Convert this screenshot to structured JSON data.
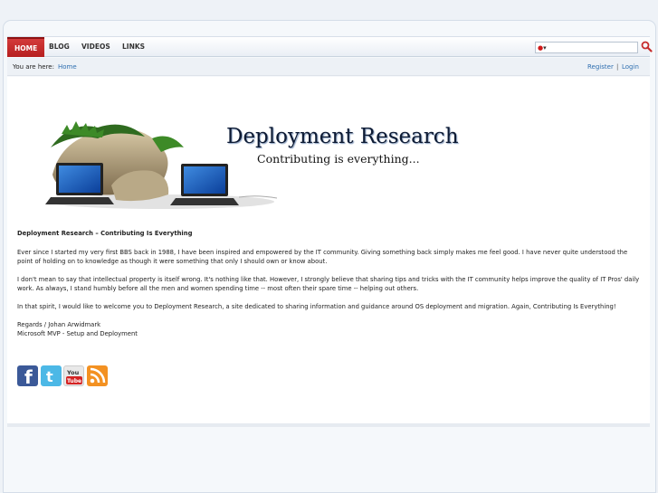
{
  "nav": {
    "items": [
      {
        "label": "HOME"
      },
      {
        "label": "BLOG"
      },
      {
        "label": "VIDEOS"
      },
      {
        "label": "LINKS"
      }
    ]
  },
  "search": {
    "value": "",
    "placeholder": "",
    "button_icon": "search-icon"
  },
  "breadcrumb": {
    "label": "You are here:",
    "home": "Home"
  },
  "auth": {
    "register": "Register",
    "separator": "|",
    "login": "Login"
  },
  "banner": {
    "title": "Deployment Research",
    "subtitle": "Contributing is everything..."
  },
  "article": {
    "heading": "Deployment Research – Contributing Is Everything",
    "p1": "Ever since I started my very first BBS back in 1988, I have been inspired and empowered by the IT community. Giving something back simply makes me feel good. I have never quite understood the point of holding on to knowledge as though it were something that only I should own or know about.",
    "p2": "I don't mean to say that intellectual property is itself wrong. It's nothing like that. However, I strongly believe that sharing tips and tricks with the IT community helps improve the quality of IT Pros' daily work. As always, I stand humbly before all the men and women spending time -- most often their spare time -- helping out others.",
    "p3": "In that spirit, I would like to welcome you to Deployment Research, a site dedicated to sharing information and guidance around OS deployment and migration. Again, Contributing Is Everything!",
    "sig1": "Regards / Johan Arwidmark",
    "sig2": "Microsoft MVP - Setup and Deployment"
  },
  "social": [
    {
      "icon": "facebook-icon",
      "color": "#3b5998"
    },
    {
      "icon": "twitter-icon",
      "color": "#4cb8e6"
    },
    {
      "icon": "youtube-icon",
      "color": "#e9e9e9"
    },
    {
      "icon": "rss-icon",
      "color": "#f39122"
    }
  ],
  "colors": {
    "accent": "#c62b2b",
    "link": "#2f6fb0"
  }
}
